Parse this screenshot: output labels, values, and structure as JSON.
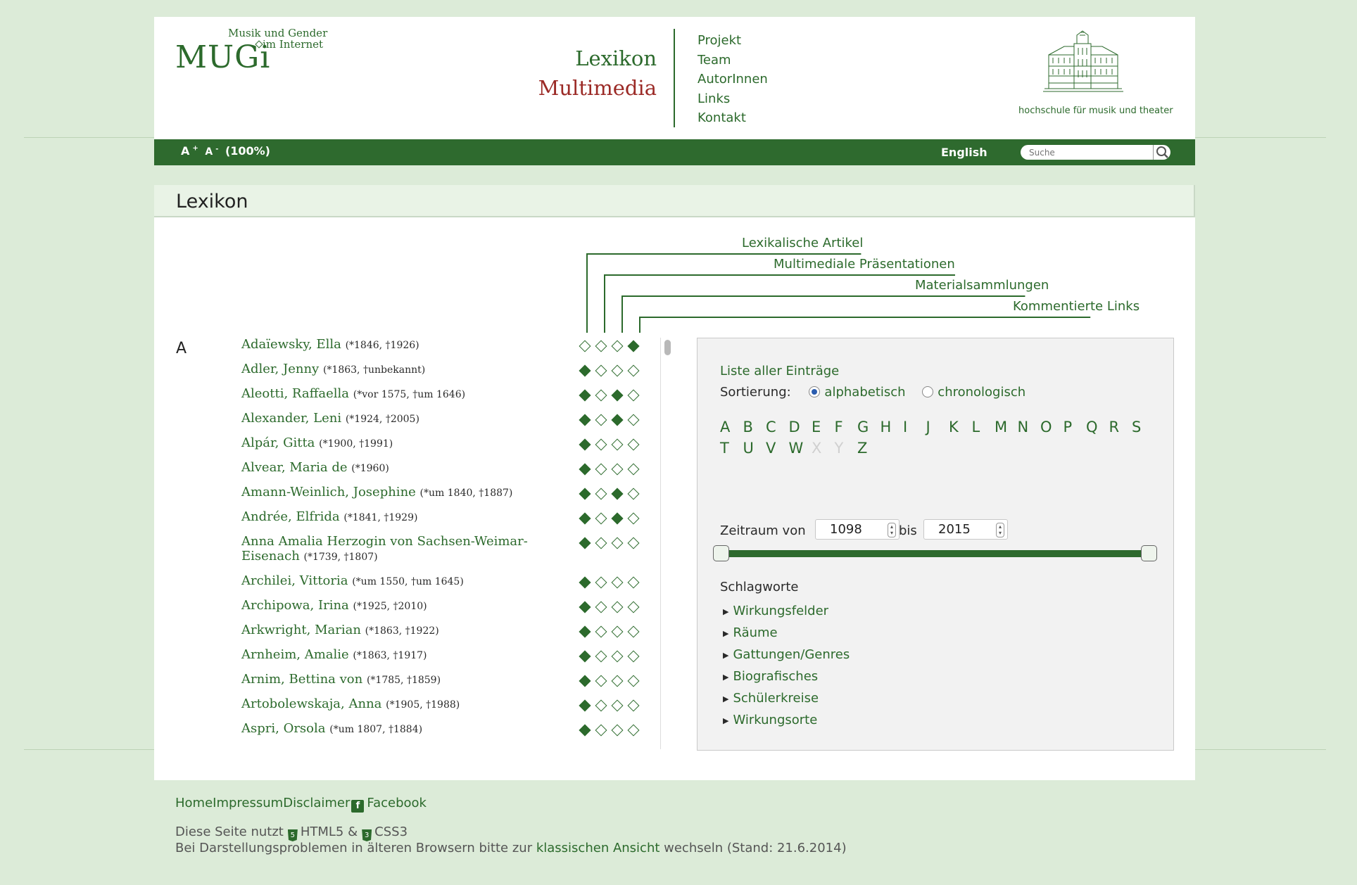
{
  "logo": {
    "name": "MUGi",
    "sub1": "Musik und Gender",
    "sub2": "im Internet"
  },
  "site": {
    "title1": "Lexikon",
    "title2": "Multimedia"
  },
  "topnav": [
    "Projekt",
    "Team",
    "AutorInnen",
    "Links",
    "Kontakt"
  ],
  "institution": "hochschule für musik und theater",
  "toolbar": {
    "font_increase": "A",
    "font_decrease": "A",
    "zoom": "(100%)",
    "language": "English",
    "search_placeholder": "Suche"
  },
  "page_title": "Lexikon",
  "legend": [
    "Lexikalische Artikel",
    "Multimediale Präsentationen",
    "Materialsammlungen",
    "Kommentierte Links"
  ],
  "letter": "A",
  "entries": [
    {
      "name": "Adaïewsky, Ella",
      "dates": "(*1846, †1926)",
      "icons": [
        0,
        0,
        0,
        1
      ]
    },
    {
      "name": "Adler, Jenny",
      "dates": "(*1863, †unbekannt)",
      "icons": [
        1,
        0,
        0,
        0
      ]
    },
    {
      "name": "Aleotti, Raffaella",
      "dates": "(*vor 1575, †um 1646)",
      "icons": [
        1,
        0,
        1,
        0
      ]
    },
    {
      "name": "Alexander, Leni",
      "dates": "(*1924, †2005)",
      "icons": [
        1,
        0,
        1,
        0
      ]
    },
    {
      "name": "Alpár, Gitta",
      "dates": "(*1900, †1991)",
      "icons": [
        1,
        0,
        0,
        0
      ]
    },
    {
      "name": "Alvear, Maria de",
      "dates": "(*1960)",
      "icons": [
        1,
        0,
        0,
        0
      ]
    },
    {
      "name": "Amann-Weinlich, Josephine",
      "dates": "(*um 1840, †1887)",
      "icons": [
        1,
        0,
        1,
        0
      ]
    },
    {
      "name": "Andrée, Elfrida",
      "dates": "(*1841, †1929)",
      "icons": [
        1,
        0,
        1,
        0
      ]
    },
    {
      "name": "Anna Amalia Herzogin von Sachsen-Weimar-Eisenach",
      "dates": "(*1739, †1807)",
      "icons": [
        1,
        0,
        0,
        0
      ]
    },
    {
      "name": "Archilei, Vittoria",
      "dates": "(*um 1550, †um 1645)",
      "icons": [
        1,
        0,
        0,
        0
      ]
    },
    {
      "name": "Archipowa, Irina",
      "dates": "(*1925, †2010)",
      "icons": [
        1,
        0,
        0,
        0
      ]
    },
    {
      "name": "Arkwright, Marian",
      "dates": "(*1863, †1922)",
      "icons": [
        1,
        0,
        0,
        0
      ]
    },
    {
      "name": "Arnheim, Amalie",
      "dates": "(*1863, †1917)",
      "icons": [
        1,
        0,
        0,
        0
      ]
    },
    {
      "name": "Arnim, Bettina von",
      "dates": "(*1785, †1859)",
      "icons": [
        1,
        0,
        0,
        0
      ]
    },
    {
      "name": "Artobolewskaja, Anna",
      "dates": "(*1905, †1988)",
      "icons": [
        1,
        0,
        0,
        0
      ]
    },
    {
      "name": "Aspri, Orsola",
      "dates": "(*um 1807, †1884)",
      "icons": [
        1,
        0,
        0,
        0
      ]
    }
  ],
  "filter": {
    "list_all": "Liste aller Einträge",
    "sort_label": "Sortierung:",
    "sort_alpha": "alphabetisch",
    "sort_chrono": "chronologisch",
    "letters": [
      "A",
      "B",
      "C",
      "D",
      "E",
      "F",
      "G",
      "H",
      "I",
      "J",
      "K",
      "L",
      "M",
      "N",
      "O",
      "P",
      "Q",
      "R",
      "S",
      "T",
      "U",
      "V",
      "W",
      "X",
      "Y",
      "Z"
    ],
    "disabled_letters": [
      "X",
      "Y"
    ],
    "zeitraum_label": "Zeitraum von",
    "year_from": "1098",
    "bis_label": "bis",
    "year_to": "2015",
    "schlagworte_title": "Schlagworte",
    "schlagworte": [
      "Wirkungsfelder",
      "Räume",
      "Gattungen/Genres",
      "Biografisches",
      "Schülerkreise",
      "Wirkungsorte"
    ]
  },
  "footer": {
    "home": "Home",
    "impressum": "Impressum",
    "disclaimer": "Disclaimer",
    "facebook": "Facebook",
    "line1_prefix": "Diese Seite nutzt",
    "html5": "HTML5",
    "amp": "&",
    "css3": "CSS3",
    "line2_prefix": "Bei Darstellungsproblemen in älteren Browsern bitte zur",
    "classic_link": "klassischen Ansicht",
    "line2_suffix": "wechseln (Stand: 21.6.2014)"
  },
  "colors": {
    "brand_green": "#2e6a2e",
    "accent_red": "#9b2a26",
    "background": "#dcebd8"
  }
}
